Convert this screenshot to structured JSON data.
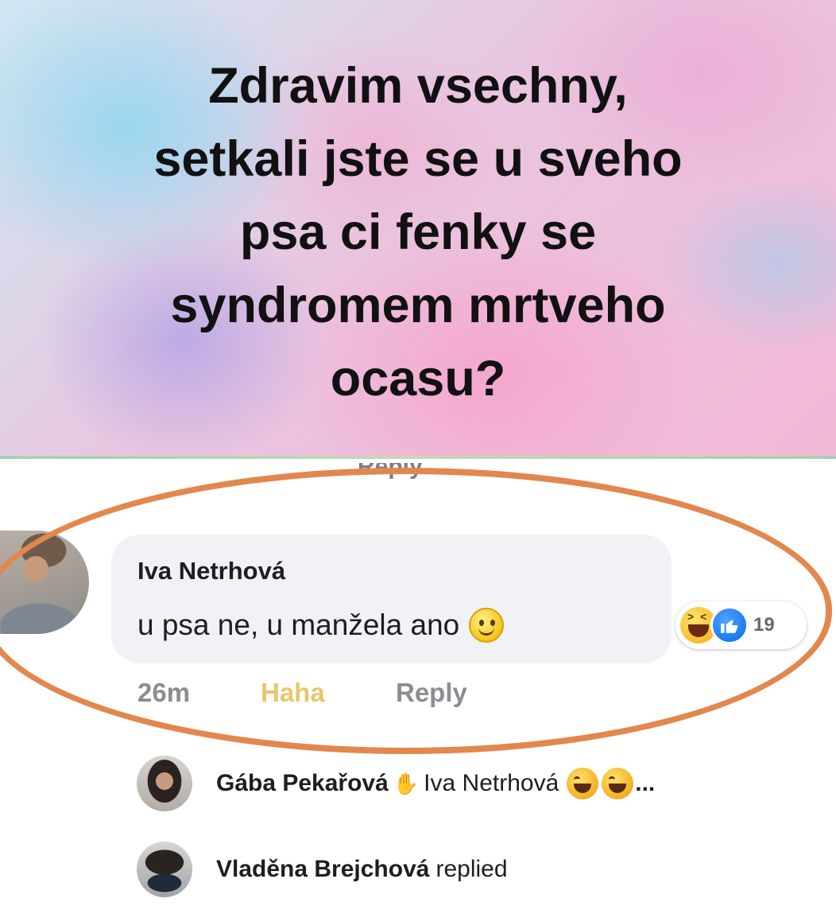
{
  "post": {
    "banner_lines": [
      "Zdravim vsechny,",
      "setkali jste se u sveho",
      "psa ci fenky se",
      "syndromem mrtveho",
      "ocasu?"
    ],
    "colors": {
      "text": "#111111",
      "highlight": "#e2874d"
    }
  },
  "previous_comment": {
    "reply_label": "Reply"
  },
  "comment": {
    "author": "Iva Netrhová",
    "text": "u psa ne, u manžela ano",
    "emoji": "smile-icon",
    "reactions": {
      "icons": [
        "haha-icon",
        "like-icon"
      ],
      "count": "19"
    },
    "time": "26m",
    "reaction_label": "Haha",
    "reply_label": "Reply"
  },
  "replies": [
    {
      "author": "Gába Pekařová",
      "icon": "wave-icon",
      "target": "Iva Netrhová",
      "emojis": [
        "laugh-icon",
        "laugh-icon"
      ],
      "trail": "..."
    },
    {
      "author": "Vladěna Brejchová",
      "suffix": "replied"
    }
  ]
}
